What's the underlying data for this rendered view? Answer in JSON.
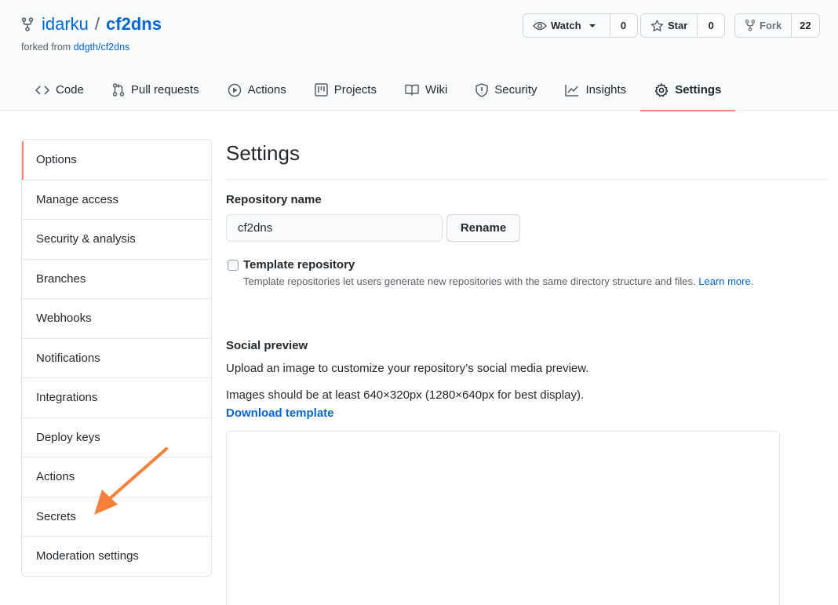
{
  "repo": {
    "owner": "idarku",
    "separator": "/",
    "name": "cf2dns",
    "forked_prefix": "forked from",
    "forked_source": "ddgth/cf2dns"
  },
  "actions": {
    "watch": {
      "label": "Watch",
      "count": "0"
    },
    "star": {
      "label": "Star",
      "count": "0"
    },
    "fork": {
      "label": "Fork",
      "count": "22"
    }
  },
  "nav": {
    "tabs": [
      {
        "label": "Code",
        "icon": "code-icon"
      },
      {
        "label": "Pull requests",
        "icon": "pull-request-icon"
      },
      {
        "label": "Actions",
        "icon": "play-icon"
      },
      {
        "label": "Projects",
        "icon": "project-icon"
      },
      {
        "label": "Wiki",
        "icon": "book-icon"
      },
      {
        "label": "Security",
        "icon": "shield-icon"
      },
      {
        "label": "Insights",
        "icon": "graph-icon"
      },
      {
        "label": "Settings",
        "icon": "gear-icon"
      }
    ],
    "active": "Settings"
  },
  "sidebar": {
    "items": [
      {
        "label": "Options"
      },
      {
        "label": "Manage access"
      },
      {
        "label": "Security & analysis"
      },
      {
        "label": "Branches"
      },
      {
        "label": "Webhooks"
      },
      {
        "label": "Notifications"
      },
      {
        "label": "Integrations"
      },
      {
        "label": "Deploy keys"
      },
      {
        "label": "Actions"
      },
      {
        "label": "Secrets"
      },
      {
        "label": "Moderation settings"
      }
    ],
    "selected": "Options"
  },
  "main": {
    "title": "Settings",
    "repo_name_label": "Repository name",
    "repo_name_value": "cf2dns",
    "rename_label": "Rename",
    "template_label": "Template repository",
    "template_note": "Template repositories let users generate new repositories with the same directory structure and files.",
    "learn_more": "Learn more",
    "learn_more_suffix": ".",
    "social_title": "Social preview",
    "social_desc": "Upload an image to customize your repository’s social media preview.",
    "social_size": "Images should be at least 640×320px (1280×640px for best display).",
    "download_template": "Download template"
  },
  "colors": {
    "accent": "#f9826c",
    "link": "#0366d6",
    "annotation_arrow": "#f5813a"
  }
}
